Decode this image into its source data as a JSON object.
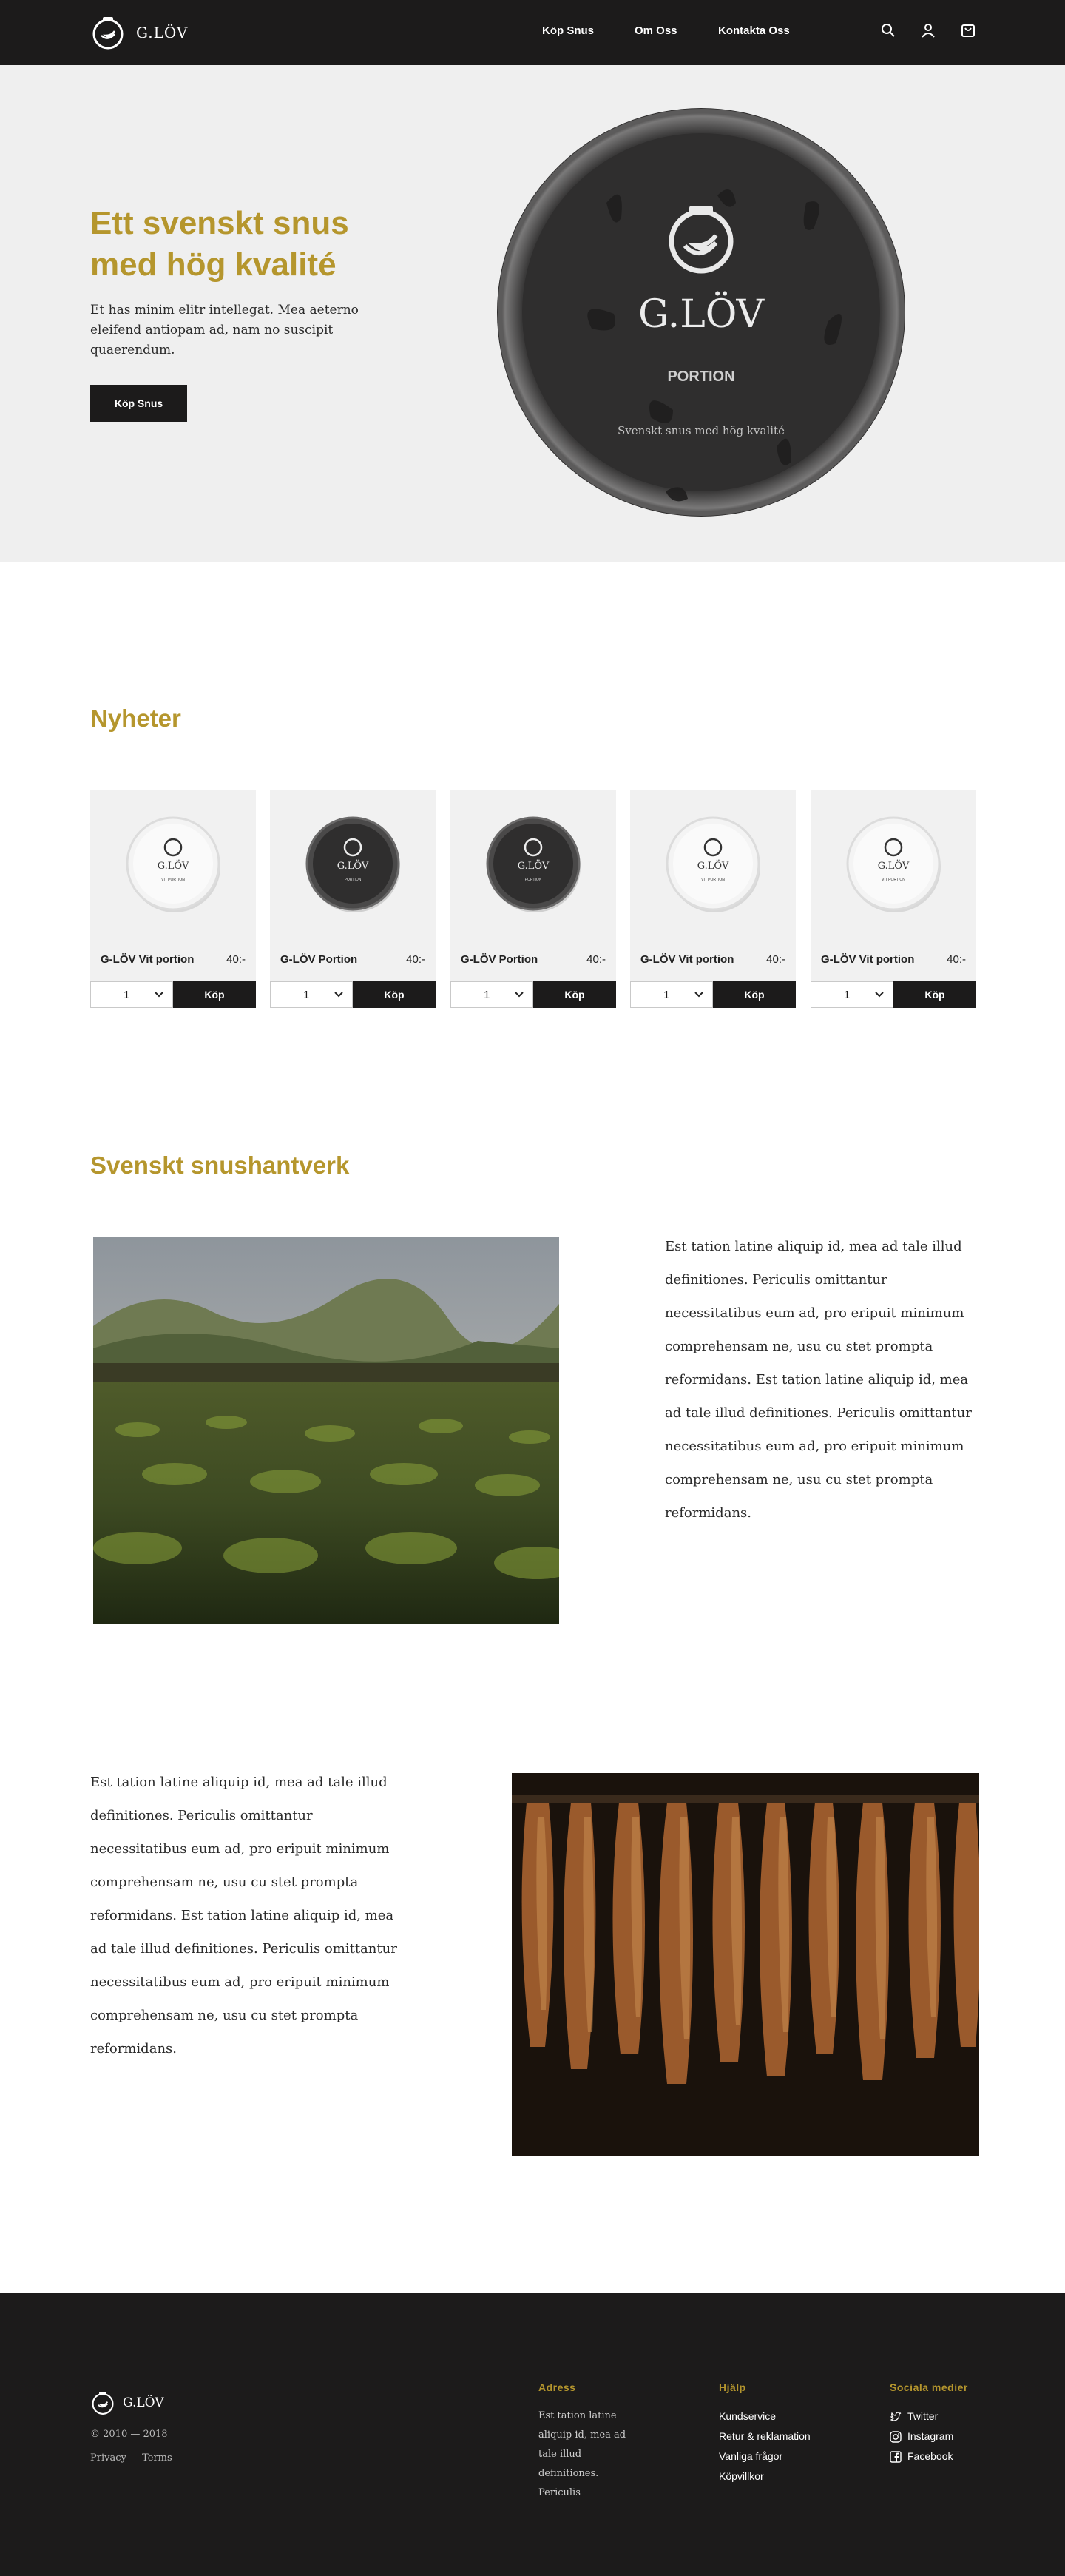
{
  "header": {
    "brand": "G.LÖV",
    "nav": [
      "Köp Snus",
      "Om Oss",
      "Kontakta Oss"
    ],
    "icons": [
      "search-icon",
      "user-icon",
      "cart-icon"
    ]
  },
  "hero": {
    "title": "Ett svenskt snus med hög kvalité",
    "text": "Et has minim elitr intellegat. Mea aeterno eleifend antiopam ad, nam no suscipit quaerendum.",
    "button": "Köp Snus",
    "tin": {
      "brand": "G.LÖV",
      "variant": "PORTION",
      "tagline": "Svenskt snus med hög kvalité"
    }
  },
  "news": {
    "title": "Nyheter",
    "products": [
      {
        "name": "G-LÖV Vit portion",
        "price": "40:-",
        "qty": "1",
        "buy": "Köp",
        "tin": "white",
        "tin_brand": "G.LÖV",
        "tin_variant": "VIT PORTION"
      },
      {
        "name": "G-LÖV Portion",
        "price": "40:-",
        "qty": "1",
        "buy": "Köp",
        "tin": "black",
        "tin_brand": "G.LÖV",
        "tin_variant": "PORTION"
      },
      {
        "name": "G-LÖV Portion",
        "price": "40:-",
        "qty": "1",
        "buy": "Köp",
        "tin": "black",
        "tin_brand": "G.LÖV",
        "tin_variant": "PORTION"
      },
      {
        "name": "G-LÖV Vit portion",
        "price": "40:-",
        "qty": "1",
        "buy": "Köp",
        "tin": "white",
        "tin_brand": "G.LÖV",
        "tin_variant": "VIT PORTION"
      },
      {
        "name": "G-LÖV Vit portion",
        "price": "40:-",
        "qty": "1",
        "buy": "Köp",
        "tin": "white",
        "tin_brand": "G.LÖV",
        "tin_variant": "VIT PORTION"
      }
    ]
  },
  "craft": {
    "title": "Svenskt snushantverk",
    "paragraph1": "Est tation latine aliquip id, mea ad tale illud definitiones. Periculis omittantur necessitatibus eum ad, pro eripuit minimum comprehensam ne, usu cu stet prompta reformidans. Est tation latine aliquip id, mea ad tale illud definitiones. Periculis omittantur necessitatibus eum ad, pro eripuit minimum comprehensam ne, usu cu stet prompta reformidans.",
    "paragraph2": "Est tation latine aliquip id, mea ad tale illud definitiones. Periculis omittantur necessitatibus eum ad, pro eripuit minimum comprehensam ne, usu cu stet prompta reformidans. Est tation latine aliquip id, mea ad tale illud definitiones. Periculis omittantur necessitatibus eum ad, pro eripuit minimum comprehensam ne, usu cu stet prompta reformidans."
  },
  "footer": {
    "brand": "G.LÖV",
    "copyright": "© 2010 — 2018",
    "legal": "Privacy — Terms",
    "address": {
      "title": "Adress",
      "lines": [
        "Est tation latine",
        "aliquip id, mea ad",
        "tale illud",
        "definitiones.",
        "Periculis"
      ]
    },
    "help": {
      "title": "Hjälp",
      "links": [
        "Kundservice",
        "Retur & reklamation",
        "Vanliga frågor",
        "Köpvillkor"
      ]
    },
    "social": {
      "title": "Sociala medier",
      "links": [
        {
          "label": "Twitter",
          "icon": "twitter-icon"
        },
        {
          "label": "Instagram",
          "icon": "instagram-icon"
        },
        {
          "label": "Facebook",
          "icon": "facebook-icon"
        }
      ]
    }
  },
  "colors": {
    "accent": "#b5962d",
    "dark": "#1c1b1b",
    "hero_bg": "#efefef"
  }
}
